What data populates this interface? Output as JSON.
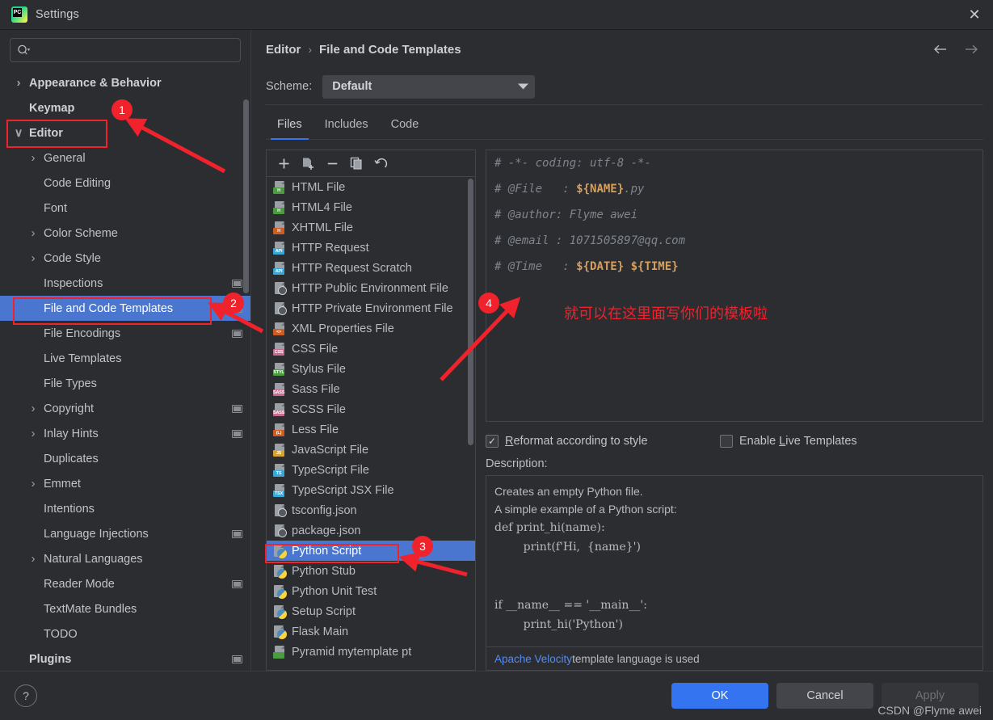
{
  "window": {
    "title": "Settings",
    "app_icon": "pycharm-logo-icon",
    "close_icon": "✕"
  },
  "search": {
    "placeholder": "",
    "value": "",
    "icon": "search-icon"
  },
  "sidebar": {
    "items": [
      {
        "label": "Appearance & Behavior",
        "level": 1,
        "chevron": "›",
        "bold": true,
        "badge": false,
        "selected": false
      },
      {
        "label": "Keymap",
        "level": 1,
        "chevron": "",
        "bold": true,
        "badge": false,
        "selected": false
      },
      {
        "label": "Editor",
        "level": 1,
        "chevron": "∨",
        "bold": true,
        "badge": false,
        "selected": false
      },
      {
        "label": "General",
        "level": 2,
        "chevron": "›",
        "bold": false,
        "badge": false,
        "selected": false
      },
      {
        "label": "Code Editing",
        "level": 2,
        "chevron": "",
        "bold": false,
        "badge": false,
        "selected": false
      },
      {
        "label": "Font",
        "level": 2,
        "chevron": "",
        "bold": false,
        "badge": false,
        "selected": false
      },
      {
        "label": "Color Scheme",
        "level": 2,
        "chevron": "›",
        "bold": false,
        "badge": false,
        "selected": false
      },
      {
        "label": "Code Style",
        "level": 2,
        "chevron": "›",
        "bold": false,
        "badge": false,
        "selected": false
      },
      {
        "label": "Inspections",
        "level": 2,
        "chevron": "",
        "bold": false,
        "badge": true,
        "selected": false
      },
      {
        "label": "File and Code Templates",
        "level": 2,
        "chevron": "",
        "bold": false,
        "badge": true,
        "selected": true
      },
      {
        "label": "File Encodings",
        "level": 2,
        "chevron": "",
        "bold": false,
        "badge": true,
        "selected": false
      },
      {
        "label": "Live Templates",
        "level": 2,
        "chevron": "",
        "bold": false,
        "badge": false,
        "selected": false
      },
      {
        "label": "File Types",
        "level": 2,
        "chevron": "",
        "bold": false,
        "badge": false,
        "selected": false
      },
      {
        "label": "Copyright",
        "level": 2,
        "chevron": "›",
        "bold": false,
        "badge": true,
        "selected": false
      },
      {
        "label": "Inlay Hints",
        "level": 2,
        "chevron": "›",
        "bold": false,
        "badge": true,
        "selected": false
      },
      {
        "label": "Duplicates",
        "level": 2,
        "chevron": "",
        "bold": false,
        "badge": false,
        "selected": false
      },
      {
        "label": "Emmet",
        "level": 2,
        "chevron": "›",
        "bold": false,
        "badge": false,
        "selected": false
      },
      {
        "label": "Intentions",
        "level": 2,
        "chevron": "",
        "bold": false,
        "badge": false,
        "selected": false
      },
      {
        "label": "Language Injections",
        "level": 2,
        "chevron": "",
        "bold": false,
        "badge": true,
        "selected": false
      },
      {
        "label": "Natural Languages",
        "level": 2,
        "chevron": "›",
        "bold": false,
        "badge": false,
        "selected": false
      },
      {
        "label": "Reader Mode",
        "level": 2,
        "chevron": "",
        "bold": false,
        "badge": true,
        "selected": false
      },
      {
        "label": "TextMate Bundles",
        "level": 2,
        "chevron": "",
        "bold": false,
        "badge": false,
        "selected": false
      },
      {
        "label": "TODO",
        "level": 2,
        "chevron": "",
        "bold": false,
        "badge": false,
        "selected": false
      },
      {
        "label": "Plugins",
        "level": 1,
        "chevron": "",
        "bold": true,
        "badge": true,
        "selected": false
      }
    ]
  },
  "breadcrumb": {
    "parent": "Editor",
    "separator": "›",
    "current": "File and Code Templates",
    "back_icon": "arrow-left-icon",
    "forward_icon": "arrow-right-icon"
  },
  "scheme": {
    "label": "Scheme:",
    "value": "Default",
    "caret_icon": "chevron-down-icon"
  },
  "tabs": [
    {
      "label": "Files",
      "active": true
    },
    {
      "label": "Includes",
      "active": false
    },
    {
      "label": "Code",
      "active": false
    }
  ],
  "list_toolbar": [
    {
      "name": "add",
      "glyph": "+"
    },
    {
      "name": "copy-template",
      "glyph": ""
    },
    {
      "name": "remove",
      "glyph": "−"
    },
    {
      "name": "duplicate",
      "glyph": ""
    },
    {
      "name": "reset",
      "glyph": "↺"
    }
  ],
  "templates": [
    {
      "label": "HTML File",
      "icon": "file-html-icon",
      "badge": "H",
      "color": "#4a9c3e",
      "selected": false
    },
    {
      "label": "HTML4 File",
      "icon": "file-html4-icon",
      "badge": "H",
      "color": "#4a9c3e",
      "selected": false
    },
    {
      "label": "XHTML File",
      "icon": "file-xhtml-icon",
      "badge": "H",
      "color": "#cf5c20",
      "selected": false
    },
    {
      "label": "HTTP Request",
      "icon": "file-http-icon",
      "badge": "API",
      "color": "#3ba7d8",
      "selected": false
    },
    {
      "label": "HTTP Request Scratch",
      "icon": "file-http-icon",
      "badge": "API",
      "color": "#3ba7d8",
      "selected": false
    },
    {
      "label": "HTTP Public Environment File",
      "icon": "file-json-icon",
      "badge": "",
      "color": "",
      "selected": false
    },
    {
      "label": "HTTP Private Environment File",
      "icon": "file-json-icon",
      "badge": "",
      "color": "",
      "selected": false
    },
    {
      "label": "XML Properties File",
      "icon": "file-xml-icon",
      "badge": "<>",
      "color": "#cf5c20",
      "selected": false
    },
    {
      "label": "CSS File",
      "icon": "file-css-icon",
      "badge": "CSS",
      "color": "#c96b8e",
      "selected": false
    },
    {
      "label": "Stylus File",
      "icon": "file-stylus-icon",
      "badge": "STYL",
      "color": "#4a9c3e",
      "selected": false
    },
    {
      "label": "Sass File",
      "icon": "file-sass-icon",
      "badge": "SASS",
      "color": "#c96b8e",
      "selected": false
    },
    {
      "label": "SCSS File",
      "icon": "file-scss-icon",
      "badge": "SASS",
      "color": "#c96b8e",
      "selected": false
    },
    {
      "label": "Less File",
      "icon": "file-less-icon",
      "badge": "(L)",
      "color": "#cf5c20",
      "selected": false
    },
    {
      "label": "JavaScript File",
      "icon": "file-js-icon",
      "badge": "JS",
      "color": "#d6a235",
      "selected": false
    },
    {
      "label": "TypeScript File",
      "icon": "file-ts-icon",
      "badge": "TS",
      "color": "#3ba7d8",
      "selected": false
    },
    {
      "label": "TypeScript JSX File",
      "icon": "file-tsx-icon",
      "badge": "TSX",
      "color": "#3ba7d8",
      "selected": false
    },
    {
      "label": "tsconfig.json",
      "icon": "file-json-icon",
      "badge": "",
      "color": "",
      "selected": false
    },
    {
      "label": "package.json",
      "icon": "file-json-icon",
      "badge": "",
      "color": "",
      "selected": false
    },
    {
      "label": "Python Script",
      "icon": "file-python-icon",
      "badge": "",
      "color": "",
      "selected": true
    },
    {
      "label": "Python Stub",
      "icon": "file-python-icon",
      "badge": "",
      "color": "",
      "selected": false
    },
    {
      "label": "Python Unit Test",
      "icon": "file-python-icon",
      "badge": "",
      "color": "",
      "selected": false
    },
    {
      "label": "Setup Script",
      "icon": "file-python-icon",
      "badge": "",
      "color": "",
      "selected": false
    },
    {
      "label": "Flask Main",
      "icon": "file-python-icon",
      "badge": "",
      "color": "",
      "selected": false
    },
    {
      "label": "Pyramid mytemplate pt",
      "icon": "file-pyramid-icon",
      "badge": "",
      "color": "#4a9c3e",
      "selected": false
    }
  ],
  "editor": {
    "lines": [
      {
        "prefix": "# -*- coding: utf-8 -*-",
        "var": "",
        "suffix": ""
      },
      {
        "prefix": "# @File   : ",
        "var": "${NAME}",
        "suffix": ".py"
      },
      {
        "prefix": "# @author: Flyme awei",
        "var": "",
        "suffix": ""
      },
      {
        "prefix": "# @email : 1071505897@qq.com",
        "var": "",
        "suffix": ""
      },
      {
        "prefix": "# @Time   : ",
        "var": "${DATE} ${TIME}",
        "suffix": ""
      }
    ],
    "annotation_cn": "就可以在这里面写你们的模板啦"
  },
  "options": {
    "reformat": {
      "label_pre": "",
      "mnemonic": "R",
      "label_post": "eformat according to style",
      "checked": true,
      "tick": "✓"
    },
    "live_templates": {
      "label_pre": "Enable ",
      "mnemonic": "L",
      "label_post": "ive Templates",
      "checked": false,
      "tick": ""
    }
  },
  "description": {
    "label": "Description:",
    "text_lines": [
      "Creates an empty Python file.",
      "A simple example of a Python script:"
    ],
    "code_lines": [
      "def print_hi(name):",
      "        print(f'Hi,  {name}')",
      "",
      "",
      "if __name__ == '__main__':",
      "        print_hi('Python')"
    ],
    "footer_link": "Apache Velocity",
    "footer_rest": " template language is used"
  },
  "footer": {
    "help_glyph": "?",
    "ok": "OK",
    "cancel": "Cancel",
    "apply": "Apply",
    "watermark": "CSDN @Flyme awei"
  },
  "annotations": [
    {
      "number": "1"
    },
    {
      "number": "2"
    },
    {
      "number": "3"
    },
    {
      "number": "4"
    }
  ],
  "colors": {
    "accent": "#3574f0",
    "selection": "#4b76cf",
    "annotation_red": "#f0222c",
    "link": "#548af7",
    "template_var": "#d9a05b"
  }
}
